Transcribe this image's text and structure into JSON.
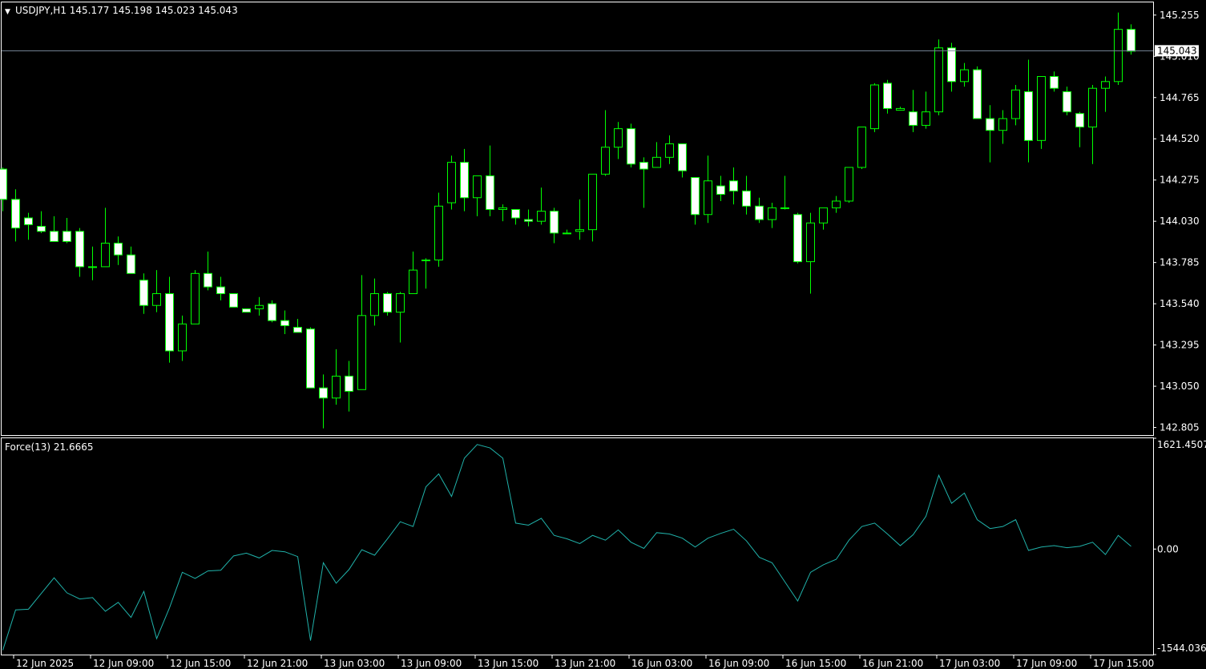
{
  "symbol_header": {
    "arrow": "▼",
    "text": "USDJPY,H1  145.177 145.198 145.023 145.043"
  },
  "indicator_header": {
    "text": "Force(13) 21.6665"
  },
  "current_price_label": "145.043",
  "colors": {
    "background": "#000000",
    "frame": "#ffffff",
    "wick": "#00ff00",
    "candle_up_fill": "#000000",
    "candle_down_fill": "#ffffff",
    "candle_outline": "#00ff00",
    "bid_line": "#778899",
    "force_line": "#20b2aa",
    "text": "#ffffff"
  },
  "chart_data": [
    {
      "type": "candlestick",
      "symbol": "USDJPY",
      "timeframe": "H1",
      "ylim": [
        142.76,
        145.335
      ],
      "price_ticks": [
        "145.255",
        "145.010",
        "144.765",
        "144.520",
        "144.275",
        "144.030",
        "143.785",
        "143.540",
        "143.295",
        "143.050",
        "142.805"
      ],
      "current_price": 145.043,
      "x_tick_labels": [
        {
          "label": "12 Jun 2025",
          "bar": 1
        },
        {
          "label": "12 Jun 09:00",
          "bar": 7
        },
        {
          "label": "12 Jun 15:00",
          "bar": 13
        },
        {
          "label": "12 Jun 21:00",
          "bar": 19
        },
        {
          "label": "13 Jun 03:00",
          "bar": 25
        },
        {
          "label": "13 Jun 09:00",
          "bar": 31
        },
        {
          "label": "13 Jun 15:00",
          "bar": 37
        },
        {
          "label": "13 Jun 21:00",
          "bar": 43
        },
        {
          "label": "16 Jun 03:00",
          "bar": 49
        },
        {
          "label": "16 Jun 09:00",
          "bar": 55
        },
        {
          "label": "16 Jun 15:00",
          "bar": 61
        },
        {
          "label": "16 Jun 21:00",
          "bar": 67
        },
        {
          "label": "17 Jun 03:00",
          "bar": 73
        },
        {
          "label": "17 Jun 09:00",
          "bar": 79
        },
        {
          "label": "17 Jun 15:00",
          "bar": 85
        }
      ],
      "ohlc": [
        [
          144.34,
          144.35,
          144.09,
          144.16
        ],
        [
          144.16,
          144.22,
          143.91,
          143.99
        ],
        [
          144.05,
          144.08,
          143.92,
          144.01
        ],
        [
          144.0,
          144.09,
          143.96,
          143.97
        ],
        [
          143.97,
          144.06,
          143.91,
          143.91
        ],
        [
          143.97,
          144.05,
          143.9,
          143.91
        ],
        [
          143.97,
          143.99,
          143.7,
          143.76
        ],
        [
          143.76,
          143.88,
          143.68,
          143.76
        ],
        [
          143.76,
          144.11,
          143.76,
          143.9
        ],
        [
          143.9,
          143.94,
          143.77,
          143.83
        ],
        [
          143.83,
          143.88,
          143.72,
          143.72
        ],
        [
          143.68,
          143.72,
          143.48,
          143.53
        ],
        [
          143.53,
          143.74,
          143.49,
          143.6
        ],
        [
          143.6,
          143.7,
          143.19,
          143.26
        ],
        [
          143.26,
          143.47,
          143.2,
          143.42
        ],
        [
          143.42,
          143.74,
          143.43,
          143.72
        ],
        [
          143.72,
          143.85,
          143.62,
          143.64
        ],
        [
          143.64,
          143.7,
          143.56,
          143.6
        ],
        [
          143.6,
          143.59,
          143.52,
          143.52
        ],
        [
          143.51,
          143.51,
          143.49,
          143.49
        ],
        [
          143.51,
          143.58,
          143.47,
          143.53
        ],
        [
          143.54,
          143.56,
          143.43,
          143.44
        ],
        [
          143.44,
          143.5,
          143.36,
          143.41
        ],
        [
          143.4,
          143.45,
          143.37,
          143.37
        ],
        [
          143.39,
          143.4,
          143.1,
          143.04
        ],
        [
          143.04,
          143.12,
          142.8,
          142.98
        ],
        [
          142.98,
          143.27,
          142.94,
          143.11
        ],
        [
          143.11,
          143.2,
          142.9,
          143.02
        ],
        [
          143.03,
          143.71,
          143.03,
          143.47
        ],
        [
          143.47,
          143.69,
          143.41,
          143.6
        ],
        [
          143.6,
          143.61,
          143.47,
          143.49
        ],
        [
          143.49,
          143.61,
          143.31,
          143.6
        ],
        [
          143.6,
          143.85,
          143.61,
          143.74
        ],
        [
          143.8,
          143.81,
          143.63,
          143.8
        ],
        [
          143.8,
          144.2,
          143.76,
          144.12
        ],
        [
          144.14,
          144.42,
          144.1,
          144.38
        ],
        [
          144.38,
          144.46,
          144.09,
          144.17
        ],
        [
          144.17,
          144.27,
          144.06,
          144.3
        ],
        [
          144.3,
          144.48,
          144.06,
          144.1
        ],
        [
          144.1,
          144.13,
          144.03,
          144.11
        ],
        [
          144.1,
          144.09,
          144.01,
          144.05
        ],
        [
          144.04,
          144.1,
          144.0,
          144.03
        ],
        [
          144.03,
          144.23,
          144.01,
          144.09
        ],
        [
          144.09,
          144.11,
          143.9,
          143.96
        ],
        [
          143.96,
          143.98,
          143.96,
          143.96
        ],
        [
          143.97,
          144.16,
          143.92,
          143.98
        ],
        [
          143.98,
          144.3,
          143.91,
          144.31
        ],
        [
          144.31,
          144.69,
          144.3,
          144.47
        ],
        [
          144.47,
          144.62,
          144.4,
          144.58
        ],
        [
          144.58,
          144.61,
          144.35,
          144.37
        ],
        [
          144.38,
          144.41,
          144.11,
          144.34
        ],
        [
          144.35,
          144.5,
          144.35,
          144.41
        ],
        [
          144.41,
          144.54,
          144.37,
          144.49
        ],
        [
          144.49,
          144.48,
          144.29,
          144.33
        ],
        [
          144.29,
          144.29,
          144.01,
          144.07
        ],
        [
          144.07,
          144.42,
          144.02,
          144.27
        ],
        [
          144.24,
          144.3,
          144.15,
          144.19
        ],
        [
          144.27,
          144.35,
          144.13,
          144.21
        ],
        [
          144.21,
          144.3,
          144.07,
          144.12
        ],
        [
          144.12,
          144.17,
          144.02,
          144.04
        ],
        [
          144.04,
          144.14,
          143.99,
          144.11
        ],
        [
          144.11,
          144.3,
          144.1,
          144.11
        ],
        [
          144.07,
          144.08,
          143.78,
          143.79
        ],
        [
          143.79,
          144.08,
          143.6,
          144.02
        ],
        [
          144.02,
          144.1,
          143.98,
          144.11
        ],
        [
          144.11,
          144.18,
          144.08,
          144.15
        ],
        [
          144.15,
          144.19,
          144.14,
          144.35
        ],
        [
          144.35,
          144.44,
          144.34,
          144.59
        ],
        [
          144.58,
          144.85,
          144.56,
          144.84
        ],
        [
          144.85,
          144.87,
          144.67,
          144.7
        ],
        [
          144.69,
          144.71,
          144.69,
          144.7
        ],
        [
          144.68,
          144.81,
          144.56,
          144.6
        ],
        [
          144.6,
          144.8,
          144.58,
          144.68
        ],
        [
          144.68,
          145.11,
          144.66,
          145.06
        ],
        [
          145.06,
          145.09,
          144.8,
          144.86
        ],
        [
          144.86,
          144.97,
          144.83,
          144.93
        ],
        [
          144.93,
          144.95,
          144.65,
          144.64
        ],
        [
          144.64,
          144.72,
          144.38,
          144.57
        ],
        [
          144.57,
          144.69,
          144.49,
          144.64
        ],
        [
          144.64,
          144.84,
          144.6,
          144.81
        ],
        [
          144.8,
          144.99,
          144.38,
          144.51
        ],
        [
          144.51,
          144.89,
          144.46,
          144.89
        ],
        [
          144.89,
          144.92,
          144.8,
          144.82
        ],
        [
          144.8,
          144.83,
          144.66,
          144.68
        ],
        [
          144.67,
          144.68,
          144.47,
          144.59
        ],
        [
          144.59,
          144.84,
          144.37,
          144.82
        ],
        [
          144.82,
          144.89,
          144.68,
          144.86
        ],
        [
          144.86,
          145.27,
          144.84,
          145.17
        ],
        [
          145.17,
          145.2,
          145.02,
          145.04
        ]
      ]
    },
    {
      "type": "line",
      "name": "Force(13)",
      "last_value": 21.6665,
      "ylim": [
        -1544.0366,
        1621.4507
      ],
      "y_tick_labels": [
        "1621.4507",
        "0.00",
        "-1544.0366"
      ],
      "values": [
        -1480,
        -890,
        -880,
        -650,
        -420,
        -640,
        -730,
        -710,
        -910,
        -780,
        -1000,
        -620,
        -1310,
        -860,
        -340,
        -430,
        -320,
        -310,
        -100,
        -60,
        -130,
        -20,
        -40,
        -110,
        -1340,
        -200,
        -500,
        -300,
        -10,
        -90,
        150,
        400,
        330,
        910,
        1100,
        770,
        1330,
        1530,
        1480,
        1330,
        380,
        350,
        450,
        200,
        150,
        80,
        200,
        130,
        280,
        100,
        10,
        240,
        220,
        160,
        30,
        160,
        230,
        290,
        120,
        -120,
        -200,
        -480,
        -760,
        -340,
        -230,
        -150,
        130,
        330,
        380,
        220,
        50,
        210,
        480,
        1080,
        670,
        820,
        430,
        300,
        330,
        430,
        -20,
        30,
        50,
        20,
        40,
        100,
        -80,
        200,
        40
      ]
    }
  ]
}
